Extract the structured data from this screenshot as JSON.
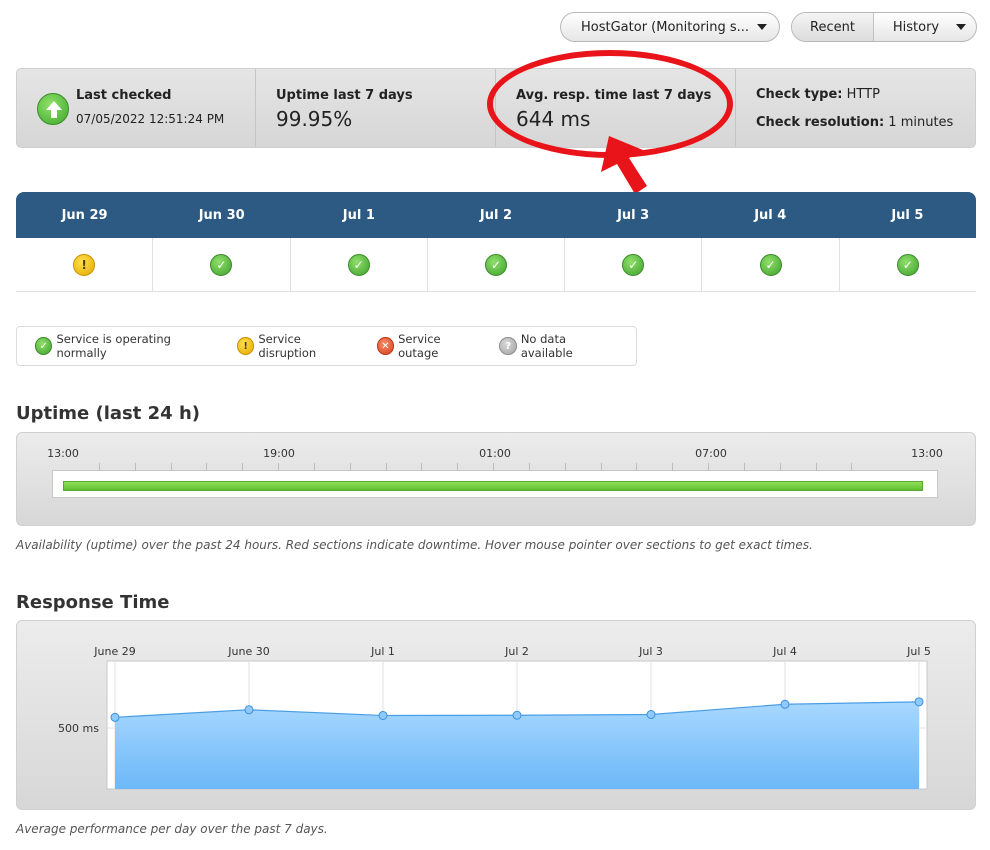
{
  "controls": {
    "monitor_select": "HostGator (Monitoring s...",
    "recent_label": "Recent",
    "history_label": "History"
  },
  "stats": {
    "last_checked_label": "Last checked",
    "last_checked_value": "07/05/2022 12:51:24 PM",
    "uptime_label": "Uptime last 7 days",
    "uptime_value": "99.95%",
    "avg_resp_label": "Avg. resp. time last 7 days",
    "avg_resp_value": "644 ms",
    "check_type_label": "Check type:",
    "check_type_value": "HTTP",
    "check_res_label": "Check resolution:",
    "check_res_value": "1 minutes"
  },
  "days": [
    {
      "label": "Jun 29",
      "status": "disruption"
    },
    {
      "label": "Jun 30",
      "status": "normal"
    },
    {
      "label": "Jul 1",
      "status": "normal"
    },
    {
      "label": "Jul 2",
      "status": "normal"
    },
    {
      "label": "Jul 3",
      "status": "normal"
    },
    {
      "label": "Jul 4",
      "status": "normal"
    },
    {
      "label": "Jul 5",
      "status": "normal"
    }
  ],
  "legend": {
    "normal": "Service is operating normally",
    "disruption": "Service disruption",
    "outage": "Service outage",
    "nodata": "No data available"
  },
  "uptime": {
    "title": "Uptime (last 24 h)",
    "ticks": [
      "13:00",
      "19:00",
      "01:00",
      "07:00",
      "13:00"
    ],
    "availability": 1.0,
    "caption": "Availability (uptime) over the past 24 hours. Red sections indicate downtime. Hover mouse pointer over sections to get exact times."
  },
  "response": {
    "title": "Response Time",
    "caption": "Average performance per day over the past 7 days."
  },
  "colors": {
    "header_blue": "#2c5a82",
    "highlight_red": "#e8141a",
    "area_blue": "#7cc3fb",
    "uptime_green": "#6fcf3a"
  },
  "chart_data": {
    "type": "area",
    "title": "",
    "x": [
      "June 29",
      "June 30",
      "Jul 1",
      "Jul 2",
      "Jul 3",
      "Jul 4",
      "Jul 5"
    ],
    "series": [
      {
        "values": [
          588,
          650,
          603,
          605,
          611,
          695,
          715
        ]
      }
    ],
    "y_tick_labels": [
      "500 ms"
    ],
    "y_tick_values": [
      500
    ],
    "ylim": [
      0,
      1050
    ],
    "grid": true
  }
}
